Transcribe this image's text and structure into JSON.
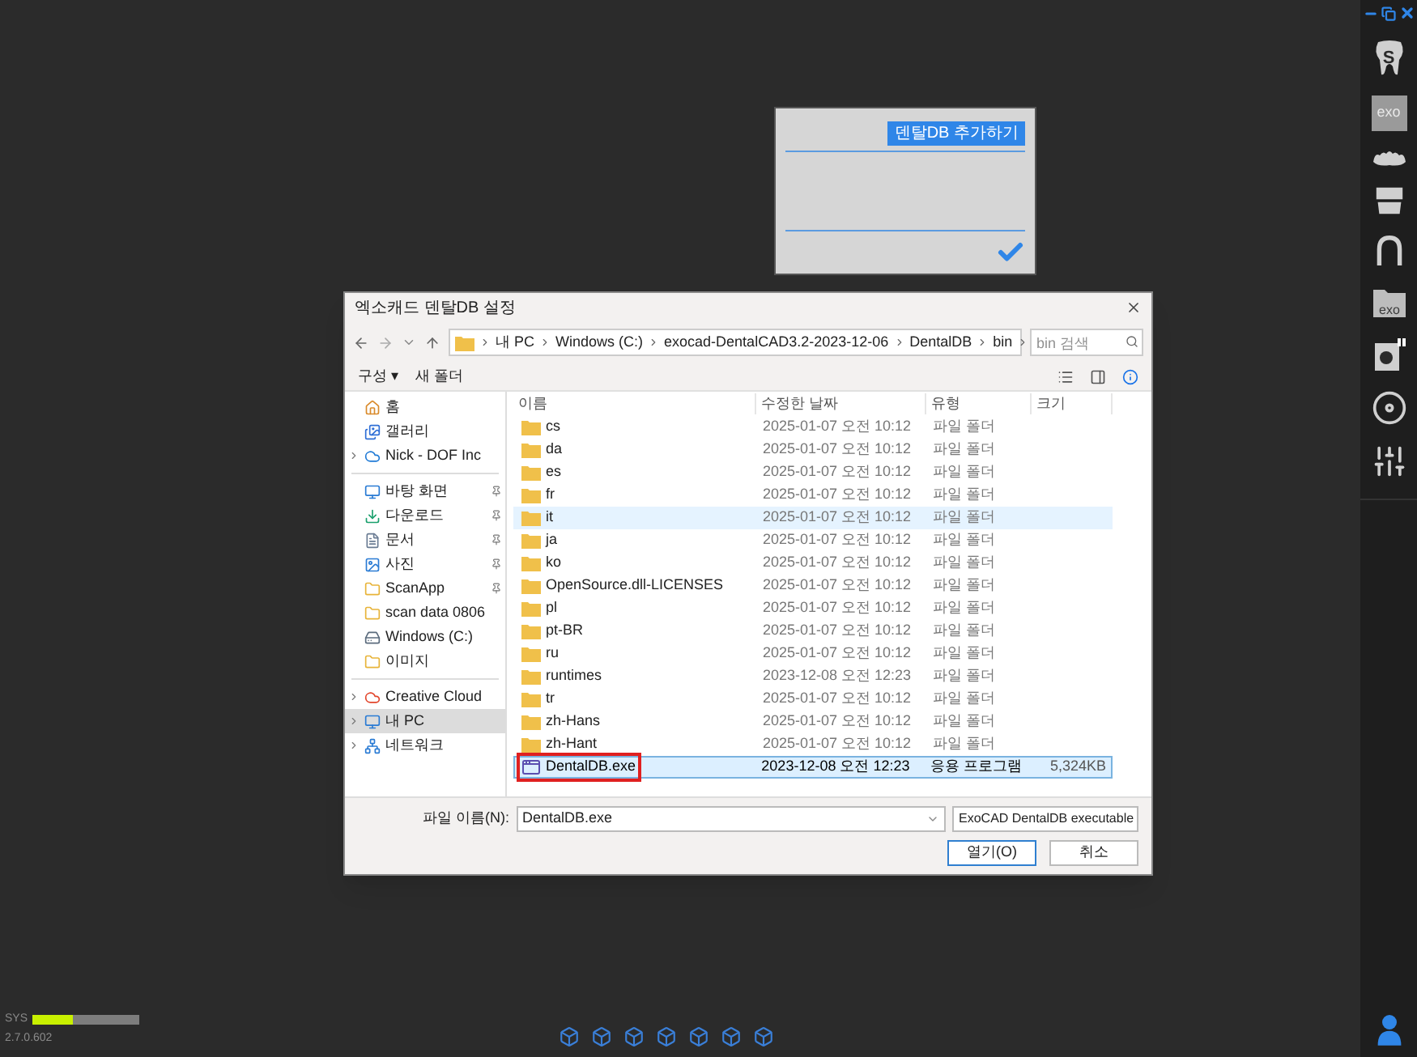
{
  "app_panel": {
    "button": "덴탈DB 추가하기"
  },
  "toolbar": {
    "tools": [
      {
        "kind": "tooth",
        "label": "S"
      },
      {
        "kind": "box",
        "label": "exo"
      },
      {
        "kind": "teeth"
      },
      {
        "kind": "jaw"
      },
      {
        "kind": "arch"
      },
      {
        "kind": "folder",
        "label": "exo"
      },
      {
        "kind": "scan"
      },
      {
        "kind": "disc"
      },
      {
        "kind": "sliders"
      }
    ]
  },
  "status": {
    "label": "SYS",
    "level": 0.38,
    "version": "2.7.0.602"
  },
  "dialog": {
    "title": "엑소캐드 덴탈DB 설정",
    "breadcrumb": [
      "내 PC",
      "Windows (C:)",
      "exocad-DentalCAD3.2-2023-12-06",
      "DentalDB",
      "bin"
    ],
    "search": {
      "placeholder": "bin 검색"
    },
    "commands": [
      "구성 ▾",
      "새 폴더"
    ],
    "sidebar": {
      "items": [
        {
          "kind": "home",
          "label": "홈",
          "selected": false,
          "pinned": false,
          "expandable": false
        },
        {
          "kind": "gallery",
          "label": "갤러리",
          "selected": false,
          "pinned": false,
          "expandable": false
        },
        {
          "kind": "cloud",
          "label": "Nick - DOF Inc",
          "selected": false,
          "pinned": false,
          "expandable": true
        },
        {
          "kind": "desktop",
          "label": "바탕 화면",
          "selected": false,
          "pinned": true,
          "expandable": false
        },
        {
          "kind": "download",
          "label": "다운로드",
          "selected": false,
          "pinned": true,
          "expandable": false
        },
        {
          "kind": "document",
          "label": "문서",
          "selected": false,
          "pinned": true,
          "expandable": false
        },
        {
          "kind": "picture",
          "label": "사진",
          "selected": false,
          "pinned": true,
          "expandable": false
        },
        {
          "kind": "folder",
          "label": "ScanApp",
          "selected": false,
          "pinned": true,
          "expandable": false
        },
        {
          "kind": "folder",
          "label": "scan data 0806",
          "selected": false,
          "pinned": false,
          "expandable": false
        },
        {
          "kind": "drive",
          "label": "Windows (C:)",
          "selected": false,
          "pinned": false,
          "expandable": false
        },
        {
          "kind": "folder",
          "label": "이미지",
          "selected": false,
          "pinned": false,
          "expandable": false
        },
        {
          "kind": "creative",
          "label": "Creative Cloud",
          "selected": false,
          "pinned": false,
          "expandable": true
        },
        {
          "kind": "pc",
          "label": "내 PC",
          "selected": true,
          "pinned": false,
          "expandable": true
        },
        {
          "kind": "network",
          "label": "네트워크",
          "selected": false,
          "pinned": false,
          "expandable": true
        }
      ]
    },
    "columns": [
      "이름",
      "수정한 날짜",
      "유형",
      "크기"
    ],
    "rows": [
      {
        "kind": "folder",
        "name": "cs",
        "modified": "2025-01-07 오전 10:12",
        "type": "파일 폴더",
        "selected": false,
        "hovered": false,
        "marked": false
      },
      {
        "kind": "folder",
        "name": "da",
        "modified": "2025-01-07 오전 10:12",
        "type": "파일 폴더",
        "selected": false,
        "hovered": false,
        "marked": false
      },
      {
        "kind": "folder",
        "name": "es",
        "modified": "2025-01-07 오전 10:12",
        "type": "파일 폴더",
        "selected": false,
        "hovered": false,
        "marked": false
      },
      {
        "kind": "folder",
        "name": "fr",
        "modified": "2025-01-07 오전 10:12",
        "type": "파일 폴더",
        "selected": false,
        "hovered": false,
        "marked": false
      },
      {
        "kind": "folder",
        "name": "it",
        "modified": "2025-01-07 오전 10:12",
        "type": "파일 폴더",
        "selected": false,
        "hovered": true,
        "marked": false
      },
      {
        "kind": "folder",
        "name": "ja",
        "modified": "2025-01-07 오전 10:12",
        "type": "파일 폴더",
        "selected": false,
        "hovered": false,
        "marked": false
      },
      {
        "kind": "folder",
        "name": "ko",
        "modified": "2025-01-07 오전 10:12",
        "type": "파일 폴더",
        "selected": false,
        "hovered": false,
        "marked": false
      },
      {
        "kind": "folder",
        "name": "OpenSource.dll-LICENSES",
        "modified": "2025-01-07 오전 10:12",
        "type": "파일 폴더",
        "selected": false,
        "hovered": false,
        "marked": false
      },
      {
        "kind": "folder",
        "name": "pl",
        "modified": "2025-01-07 오전 10:12",
        "type": "파일 폴더",
        "selected": false,
        "hovered": false,
        "marked": false
      },
      {
        "kind": "folder",
        "name": "pt-BR",
        "modified": "2025-01-07 오전 10:12",
        "type": "파일 폴더",
        "selected": false,
        "hovered": false,
        "marked": false
      },
      {
        "kind": "folder",
        "name": "ru",
        "modified": "2025-01-07 오전 10:12",
        "type": "파일 폴더",
        "selected": false,
        "hovered": false,
        "marked": false
      },
      {
        "kind": "folder",
        "name": "runtimes",
        "modified": "2023-12-08 오전 12:23",
        "type": "파일 폴더",
        "selected": false,
        "hovered": false,
        "marked": false
      },
      {
        "kind": "folder",
        "name": "tr",
        "modified": "2025-01-07 오전 10:12",
        "type": "파일 폴더",
        "selected": false,
        "hovered": false,
        "marked": false
      },
      {
        "kind": "folder",
        "name": "zh-Hans",
        "modified": "2025-01-07 오전 10:12",
        "type": "파일 폴더",
        "selected": false,
        "hovered": false,
        "marked": false
      },
      {
        "kind": "folder",
        "name": "zh-Hant",
        "modified": "2025-01-07 오전 10:12",
        "type": "파일 폴더",
        "selected": false,
        "hovered": false,
        "marked": false
      },
      {
        "kind": "exe",
        "name": "DentalDB.exe",
        "modified": "2023-12-08 오전 12:23",
        "type": "응용 프로그램",
        "size": "5,324KB",
        "selected": true,
        "hovered": false,
        "marked": true
      }
    ],
    "filename_label": "파일 이름(N):",
    "filename": "DentalDB.exe",
    "filter": "ExoCAD DentalDB executable",
    "buttons": [
      "열기(O)",
      "취소"
    ]
  }
}
